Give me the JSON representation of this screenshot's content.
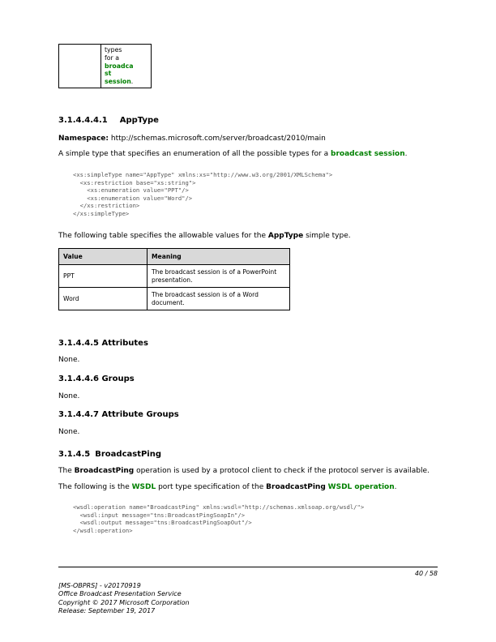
{
  "fragment_table": {
    "lead": "types for a",
    "link_lines": [
      "broadca",
      "st",
      "session"
    ],
    "tail": "."
  },
  "section_apptype": {
    "number": "3.1.4.4.4.1",
    "title": "AppType",
    "namespace_label": "Namespace:",
    "namespace_value": "http://schemas.microsoft.com/server/broadcast/2010/main",
    "desc_before": "A simple type that specifies an enumeration of all the possible types for a ",
    "desc_link": "broadcast session",
    "desc_after": ".",
    "code": "<xs:simpleType name=\"AppType\" xmlns:xs=\"http://www.w3.org/2001/XMLSchema\">\n  <xs:restriction base=\"xs:string\">\n    <xs:enumeration value=\"PPT\"/>\n    <xs:enumeration value=\"Word\"/>\n  </xs:restriction>\n</xs:simpleType>",
    "table_intro_before": "The following table specifies the allowable values for the ",
    "table_intro_bold": "AppType",
    "table_intro_after": " simple type."
  },
  "values_table": {
    "headers": [
      "Value",
      "Meaning"
    ],
    "rows": [
      [
        "PPT",
        "The broadcast session is of a PowerPoint presentation."
      ],
      [
        "Word",
        "The broadcast session is of a Word document."
      ]
    ]
  },
  "attributes": {
    "title": "3.1.4.4.5 Attributes",
    "body": "None."
  },
  "groups": {
    "title": "3.1.4.4.6 Groups",
    "body": "None."
  },
  "attribute_groups": {
    "title": "3.1.4.4.7 Attribute Groups",
    "body": "None."
  },
  "section_ping": {
    "number": "3.1.4.5",
    "title": "BroadcastPing",
    "p1_before": "The ",
    "p1_bold": "BroadcastPing",
    "p1_after": " operation is used by a protocol client to check if the protocol server is available.",
    "p2_before": "The following is the ",
    "p2_link1": "WSDL",
    "p2_mid": " port type specification of the ",
    "p2_bold": "BroadcastPing",
    "p2_space": " ",
    "p2_link2": "WSDL operation",
    "p2_after": ".",
    "code": "<wsdl:operation name=\"BroadcastPing\" xmlns:wsdl=\"http://schemas.xmlsoap.org/wsdl/\">\n  <wsdl:input message=\"tns:BroadcastPingSoapIn\"/>\n  <wsdl:output message=\"tns:BroadcastPingSoapOut\"/>\n</wsdl:operation>"
  },
  "footer": {
    "page": "40 / 58",
    "doc_id": "[MS-OBPRS] - v20170919",
    "doc_title": "Office Broadcast Presentation Service",
    "copyright": "Copyright © 2017 Microsoft Corporation",
    "release": "Release: September 19, 2017"
  },
  "colors": {
    "link": "#008000",
    "table_header": "#d9d9d9",
    "code": "#555555"
  }
}
